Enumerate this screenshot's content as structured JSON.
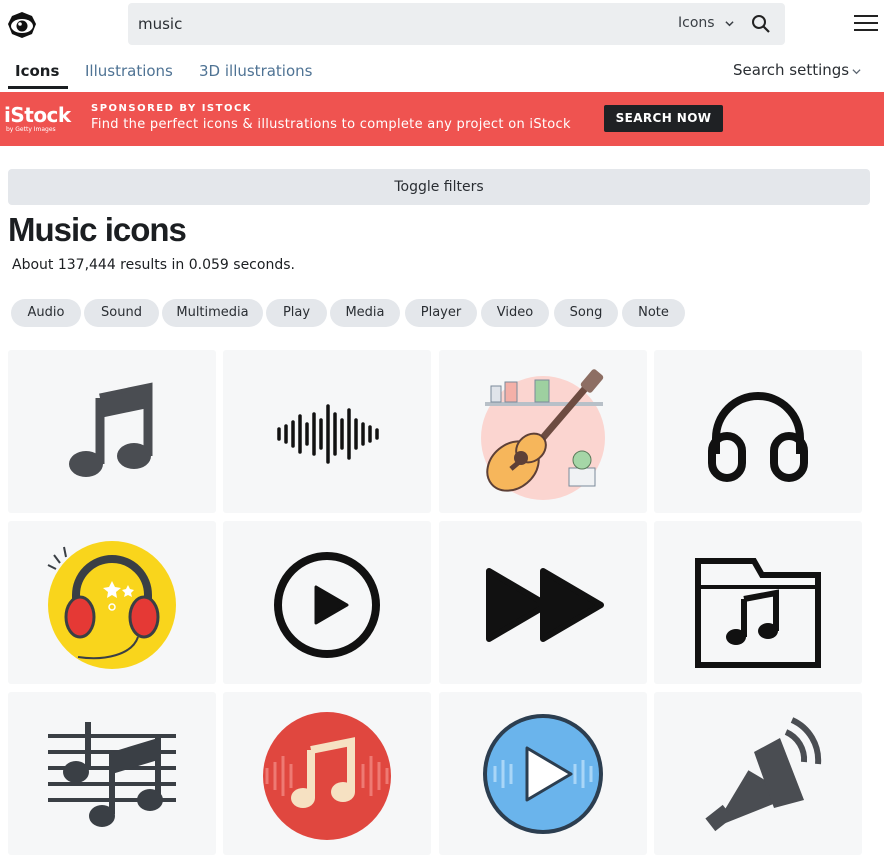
{
  "search": {
    "query": "music",
    "type": "Icons"
  },
  "tabs": [
    {
      "label": "Icons",
      "active": true
    },
    {
      "label": "Illustrations",
      "active": false
    },
    {
      "label": "3D illustrations",
      "active": false
    }
  ],
  "search_settings": "Search settings",
  "banner": {
    "brand": "iStock",
    "brand_sub": "by Getty Images",
    "sponsored": "SPONSORED BY ISTOCK",
    "text": "Find the perfect icons & illustrations to complete any project on iStock",
    "button": "SEARCH NOW",
    "color": "#ef5350"
  },
  "toggle_filters": "Toggle filters",
  "heading": "Music icons",
  "results": "About 137,444 results in 0.059 seconds.",
  "chips": [
    "Audio",
    "Sound",
    "Multimedia",
    "Play",
    "Media",
    "Player",
    "Video",
    "Song",
    "Note"
  ],
  "icons": [
    "music-notes-icon",
    "sound-wave-icon",
    "guitar-illustration-icon",
    "headphones-icon",
    "yellow-headphones-icon",
    "play-circle-icon",
    "fast-forward-icon",
    "music-folder-icon",
    "sheet-music-icon",
    "red-music-note-icon",
    "blue-play-circle-icon",
    "megaphone-icon"
  ]
}
